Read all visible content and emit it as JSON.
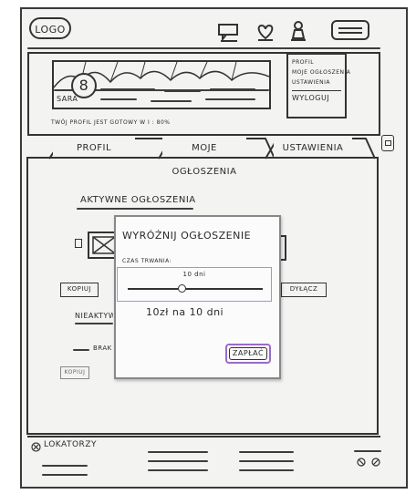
{
  "header": {
    "logo_text": "LOGO",
    "icons": [
      "chat-icon",
      "heart-icon",
      "user-icon",
      "menu-icon"
    ]
  },
  "profile": {
    "avatar_number": "8",
    "name": "SARA",
    "completion_note": "TWÓJ PROFIL JEST GOTOWY W I : 80%"
  },
  "account_menu": {
    "items": [
      "PROFIL",
      "MOJE OGŁOSZENIA",
      "USTAWIENIA"
    ],
    "logout": "WYLOGUJ"
  },
  "tabs": [
    "PROFIL",
    "MOJE OGŁOSZENIA",
    "USTAWIENIA"
  ],
  "listings": {
    "section_title": "AKTYWNE OGŁOSZENIA",
    "edit_button": "KOPIUJ",
    "inactive_title": "NIEAKTYWNE",
    "draft_label": "BRAK",
    "small_button": "KOPIUJ",
    "disable_button": "DYŁĄCZ"
  },
  "modal": {
    "title": "WYRÓŻNIJ OGŁOSZENIE",
    "duration_label": "CZAS TRWANIA:",
    "slider_value_label": "10 dni",
    "slider_fraction": 0.4,
    "price_text": "10zł na 10 dni",
    "save_button": "ZAPŁAĆ"
  },
  "footer": {
    "brand": "LOKATORZY"
  }
}
